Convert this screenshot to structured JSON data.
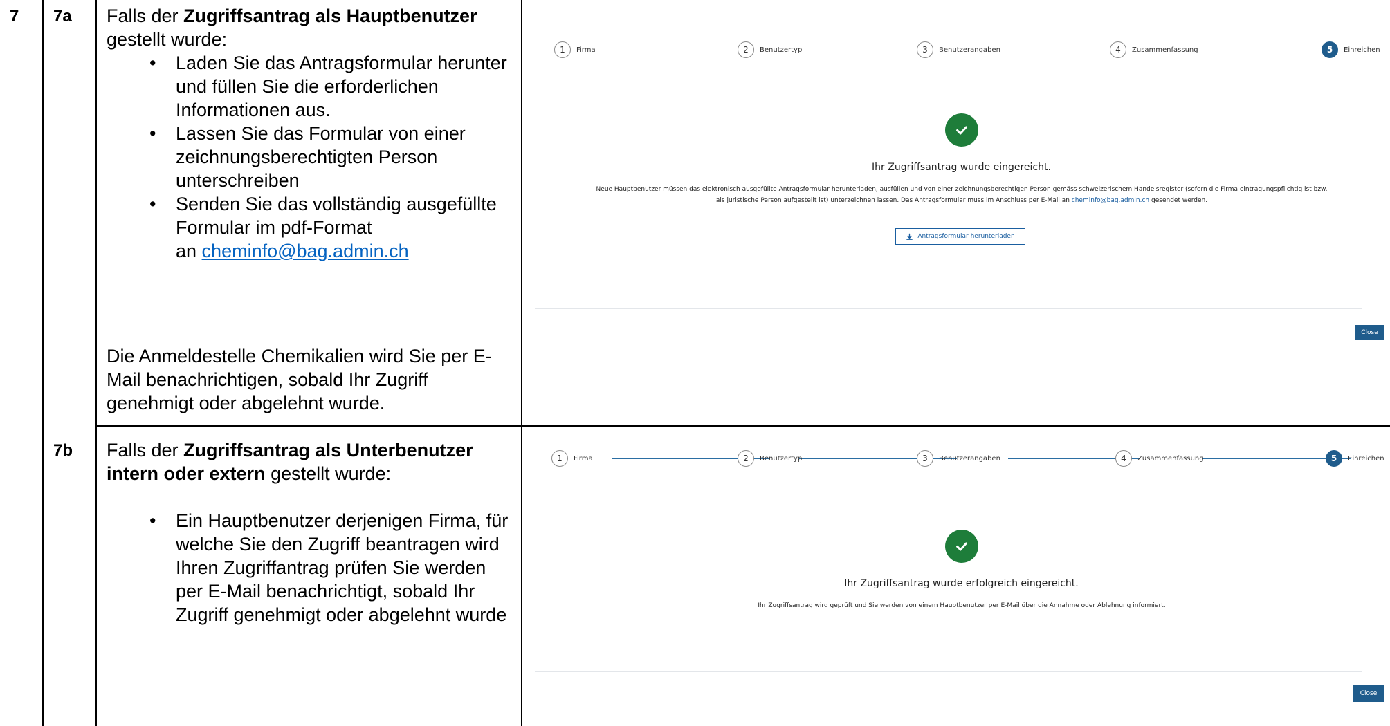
{
  "rows": {
    "step": "7",
    "a": {
      "sub": "7a",
      "intro_pre": "Falls der ",
      "intro_bold": "Zugriffsantrag als Hauptbenutzer",
      "intro_post": "gestellt wurde:",
      "bullets": [
        "Laden Sie das Antragsformular herunter und füllen Sie die erforderlichen Informationen aus.",
        "Lassen Sie das Formular von einer zeichnungsberechtigten Person unterschreiben",
        "Senden Sie das vollständig ausgefüllte Formular im pdf-Format"
      ],
      "bullet3_link_prefix": "an ",
      "email": "cheminfo@bag.admin.ch",
      "notice": "Die Anmeldestelle Chemikalien wird Sie per E-Mail benachrichtigen, sobald Ihr Zugriff genehmigt oder abgelehnt wurde."
    },
    "b": {
      "sub": "7b",
      "intro_pre": "Falls der ",
      "intro_bold": "Zugriffsantrag als Unterbenutzer intern oder extern",
      "intro_post": " gestellt wurde:",
      "bullets": [
        "Ein Hauptbenutzer derjenigen Firma, für welche Sie den Zugriff beantragen wird Ihren Zugriffantrag prüfen Sie werden per E-Mail benachrichtigt, sobald Ihr Zugriff genehmigt oder abgelehnt wurde"
      ]
    }
  },
  "screenshot_a": {
    "steps": [
      {
        "num": "1",
        "label": "Firma"
      },
      {
        "num": "2",
        "label": "Benutzertyp"
      },
      {
        "num": "3",
        "label": "Benutzerangaben"
      },
      {
        "num": "4",
        "label": "Zusammenfassung"
      },
      {
        "num": "5",
        "label": "Einreichen"
      }
    ],
    "title": "Ihr Zugriffsantrag wurde eingereicht.",
    "text_1": "Neue Hauptbenutzer müssen das elektronisch ausgefüllte Antragsformular herunterladen, ausfüllen und von einer zeichnungsberechtigen Person gemäss schweizerischem Handelsregister (sofern die Firma eintragungspflichtig ist bzw.",
    "text_2": "als juristische Person aufgestellt ist) unterzeichnen lassen. Das Antragsformular muss im Anschluss per E-Mail an",
    "text_email": "cheminfo@bag.admin.ch",
    "text_3": "gesendet werden.",
    "download_label": "Antragsformular herunterladen",
    "close_label": "Close"
  },
  "screenshot_b": {
    "steps": [
      {
        "num": "1",
        "label": "Firma"
      },
      {
        "num": "2",
        "label": "Benutzertyp"
      },
      {
        "num": "3",
        "label": "Benutzerangaben"
      },
      {
        "num": "4",
        "label": "Zusammenfassung"
      },
      {
        "num": "5",
        "label": "Einreichen"
      }
    ],
    "title": "Ihr Zugriffsantrag wurde erfolgreich eingereicht.",
    "text": "Ihr Zugriffsantrag wird geprüft und Sie werden von einem Hauptbenutzer per E-Mail über die Annahme oder Ablehnung informiert.",
    "close_label": "Close"
  },
  "colors": {
    "primary": "#1f5c8c",
    "success": "#1e7d3a",
    "link": "#0563c1",
    "connector": "#2b6ea3"
  },
  "icons": [
    "check-icon",
    "download-icon"
  ]
}
